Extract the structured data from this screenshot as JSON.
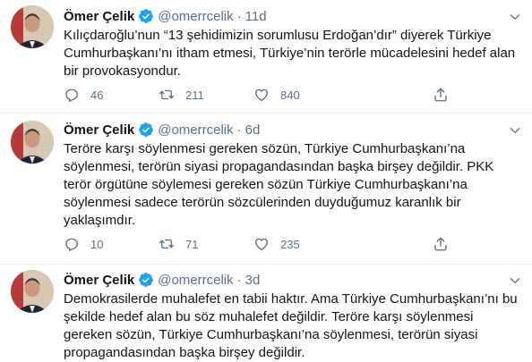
{
  "author": {
    "name": "Ömer Çelik",
    "handle": "@omerrcelik",
    "dot": "·"
  },
  "tweets": [
    {
      "time": "11d",
      "text": "Kılıçdaroğlu’nun “13 şehidimizin sorumlusu Erdoğan’dır” diyerek Türkiye Cumhurbaşkanı’nı itham etmesi, Türkiye’nin terörle mücadelesini hedef alan bir provokasyondur.",
      "replies": "46",
      "retweets": "211",
      "likes": "840"
    },
    {
      "time": "6d",
      "text": "Teröre karşı söylenmesi gereken sözün, Türkiye Cumhurbaşkanı’na söylenmesi, terörün siyasi propagandasından başka birşey değildir. PKK terör örgütüne söylemesi gereken sözün Türkiye Cumhurbaşkanı’na söylenmesi sadece terörün sözcülerinden duyduğumuz karanlık bir yaklaşımdır.",
      "replies": "10",
      "retweets": "71",
      "likes": "235"
    },
    {
      "time": "3d",
      "text": "Demokrasilerde muhalefet en tabii haktır. Ama Türkiye Cumhurbaşkanı’nı bu şekilde hedef alan bu söz muhalefet değildir. Teröre karşı söylenmesi gereken sözün, Türkiye Cumhurbaşkanı’na söylenmesi, terörün siyasi propagandasından başka birşey değildir."
    }
  ],
  "icons": {
    "verified": "verified-badge-icon",
    "reply": "reply-icon",
    "retweet": "retweet-icon",
    "like": "like-icon",
    "share": "share-icon",
    "more": "chevron-down-icon"
  },
  "colors": {
    "verified": "#1da1f2",
    "muted": "#5b7083",
    "text": "#0f1419",
    "divider": "#e6ecf0"
  }
}
